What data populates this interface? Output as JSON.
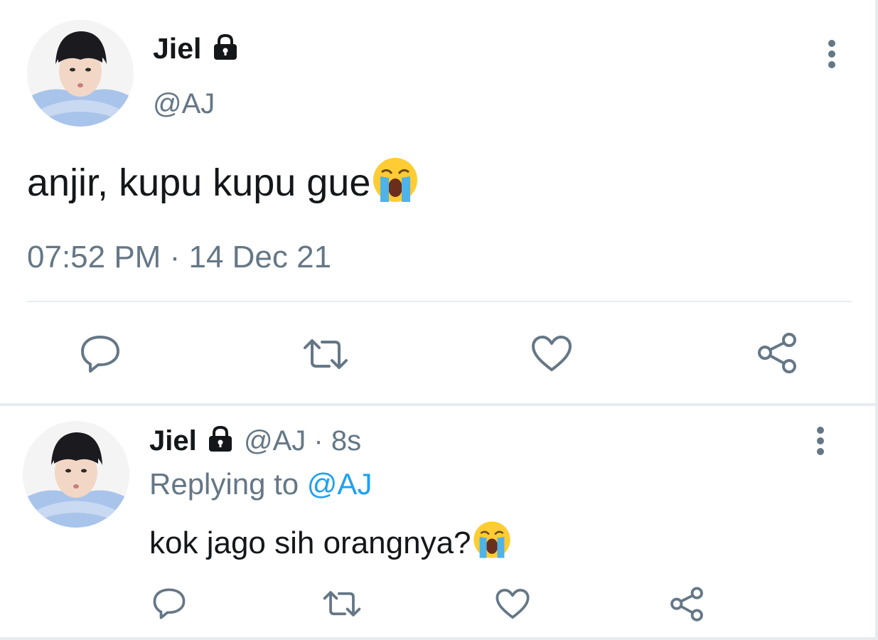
{
  "main_tweet": {
    "display_name": "Jiel",
    "handle": "@AJ",
    "text": "anjir, kupu kupu gue",
    "time": "07:52 PM",
    "separator": "·",
    "date": "14 Dec 21"
  },
  "reply_tweet": {
    "display_name": "Jiel",
    "handle": "@AJ",
    "separator": "·",
    "age": "8s",
    "replying_label": "Replying to",
    "replying_handle": "@AJ",
    "text": "kok jago sih orangnya?"
  },
  "icons": {
    "lock": "lock-icon",
    "emoji": "loudly-crying-face-emoji",
    "reply": "reply-icon",
    "retweet": "retweet-icon",
    "like": "heart-icon",
    "share": "share-icon",
    "more": "more-vertical-icon"
  },
  "colors": {
    "text": "#14171a",
    "muted": "#657786",
    "link": "#1da1f2",
    "divider": "#e6ecf0"
  }
}
